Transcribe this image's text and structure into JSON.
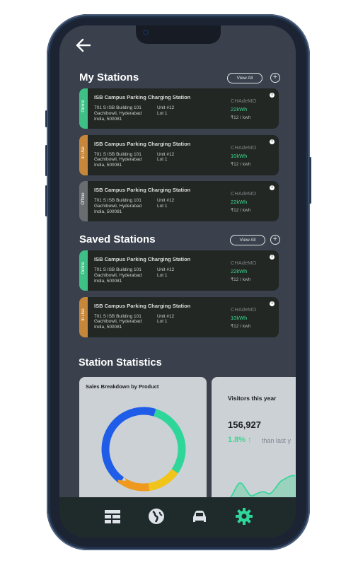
{
  "header": {
    "back_icon": "back-arrow-icon"
  },
  "my_stations": {
    "title": "My Stations",
    "view_all": "View All",
    "add_icon": "plus-icon",
    "stations": [
      {
        "status": "Online",
        "status_color": "#3dbf86",
        "name": "ISB Campus Parking Charging Station",
        "address": [
          "701 S ISB Building 101",
          "Gachibowli, Hyderabad",
          "India, 500081"
        ],
        "unit": [
          "Unit #12",
          "Lot 1"
        ],
        "connector": "CHAdeMO",
        "power": "22kWh",
        "price": "₹12 / kwh"
      },
      {
        "status": "In Use",
        "status_color": "#c7873a",
        "name": "ISB Campus Parking Charging Station",
        "address": [
          "701 S ISB Building 101",
          "Gachibowli, Hyderabad",
          "India, 500081"
        ],
        "unit": [
          "Unit #12",
          "Lot 1"
        ],
        "connector": "CHAdeMO",
        "power": "10kWh",
        "price": "₹12 / kwh"
      },
      {
        "status": "Offline",
        "status_color": "#6a6d70",
        "name": "ISB Campus Parking Charging Station",
        "address": [
          "701 S ISB Building 101",
          "Gachibowli, Hyderabad",
          "India, 500081"
        ],
        "unit": [
          "Unit #12",
          "Lot 1"
        ],
        "connector": "CHAdeMO",
        "power": "22kWh",
        "price": "₹12 / kwh"
      }
    ]
  },
  "saved_stations": {
    "title": "Saved Stations",
    "view_all": "View All",
    "add_icon": "plus-icon",
    "stations": [
      {
        "status": "Online",
        "status_color": "#3dbf86",
        "name": "ISB Campus Parking Charging Station",
        "address": [
          "701 S ISB Building 101",
          "Gachibowli, Hyderabad",
          "India, 500081"
        ],
        "unit": [
          "Unit #12",
          "Lot 1"
        ],
        "connector": "CHAdeMO",
        "power": "22kWh",
        "price": "₹12 / kwh"
      },
      {
        "status": "In Use",
        "status_color": "#c7873a",
        "name": "ISB Campus Parking Charging Station",
        "address": [
          "701 S ISB Building 101",
          "Gachibowli, Hyderabad",
          "India, 500081"
        ],
        "unit": [
          "Unit #12",
          "Lot 1"
        ],
        "connector": "CHAdeMO",
        "power": "10kWh",
        "price": "₹12 / kwh"
      }
    ]
  },
  "statistics": {
    "title": "Station Statistics",
    "sales": {
      "title": "Sales Breakdown by Product",
      "segments": [
        {
          "color": "#1f5de8",
          "share": 0.45
        },
        {
          "color": "#2fd69a",
          "share": 0.3
        },
        {
          "color": "#f0c419",
          "share": 0.13
        },
        {
          "color": "#ef9a1f",
          "share": 0.12
        }
      ]
    },
    "visitors": {
      "title": "Visitors this year",
      "value": "156,927",
      "change": "1.8%",
      "arrow": "↑",
      "suffix": "than last y"
    }
  },
  "navbar": {
    "items": [
      {
        "icon": "dashboard-icon",
        "active": false
      },
      {
        "icon": "globe-icon",
        "active": false
      },
      {
        "icon": "car-icon",
        "active": false
      },
      {
        "icon": "settings-icon",
        "active": true
      }
    ],
    "active_color": "#2fd69a",
    "inactive_color": "#dde3e8"
  },
  "colors": {
    "screen_bg": "#3a414d",
    "card_bg": "#222724",
    "accent_green": "#3ed58e"
  }
}
